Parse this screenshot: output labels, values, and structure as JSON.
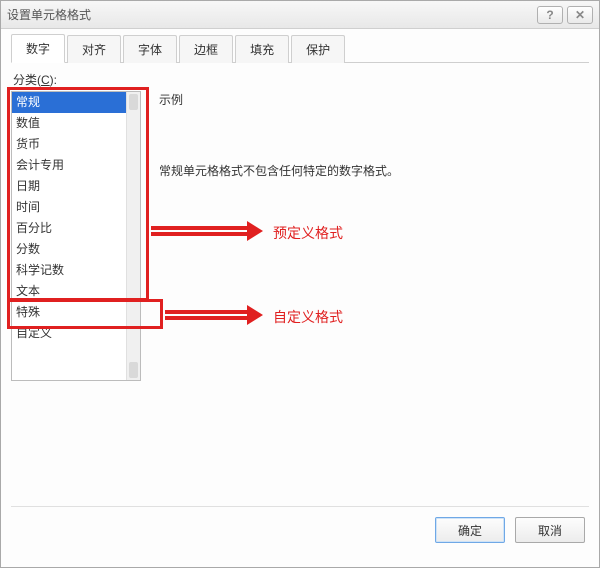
{
  "window": {
    "title": "设置单元格格式",
    "help_glyph": "?",
    "close_glyph": "✕"
  },
  "tabs": {
    "items": [
      "数字",
      "对齐",
      "字体",
      "边框",
      "填充",
      "保护"
    ],
    "active_index": 0
  },
  "category": {
    "label_prefix": "分类(",
    "label_hotkey": "C",
    "label_suffix": "):",
    "items": [
      "常规",
      "数值",
      "货币",
      "会计专用",
      "日期",
      "时间",
      "百分比",
      "分数",
      "科学记数",
      "文本",
      "特殊",
      "自定义"
    ],
    "selected_index": 0
  },
  "sample": {
    "label": "示例",
    "value": ""
  },
  "description": "常规单元格格式不包含任何特定的数字格式。",
  "annotations": {
    "predefined_label": "预定义格式",
    "custom_label": "自定义格式"
  },
  "buttons": {
    "ok": "确定",
    "cancel": "取消"
  }
}
